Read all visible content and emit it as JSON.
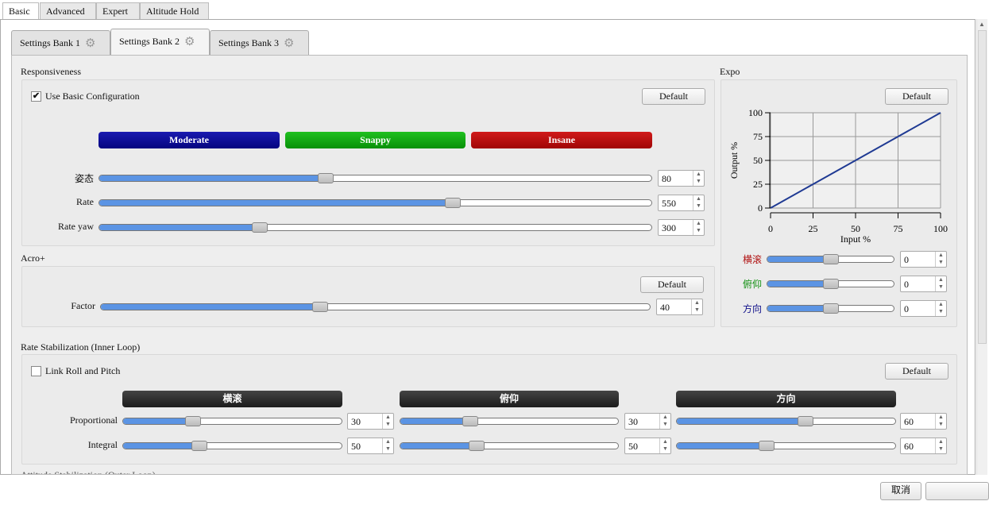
{
  "top_tabs": [
    "Basic",
    "Advanced",
    "Expert",
    "Altitude Hold"
  ],
  "bank_tabs": [
    "Settings Bank 1",
    "Settings Bank 2",
    "Settings Bank 3"
  ],
  "responsiveness": {
    "title": "Responsiveness",
    "use_basic": {
      "label": "Use Basic Configuration",
      "checked": true
    },
    "default_label": "Default",
    "presets": [
      {
        "label": "Moderate",
        "color": "#0a0a9a"
      },
      {
        "label": "Snappy",
        "color": "#12a812"
      },
      {
        "label": "Insane",
        "color": "#b80a0a"
      }
    ],
    "rows": [
      {
        "label": "姿态",
        "value": "80",
        "level": 0.41
      },
      {
        "label": "Rate",
        "value": "550",
        "level": 0.64
      },
      {
        "label": "Rate yaw",
        "value": "300",
        "level": 0.29
      }
    ]
  },
  "acro": {
    "title": "Acro+",
    "default_label": "Default",
    "rows": [
      {
        "label": "Factor",
        "value": "40",
        "level": 0.4
      }
    ]
  },
  "expo": {
    "title": "Expo",
    "default_label": "Default",
    "rows": [
      {
        "label": "横滚",
        "value": "0",
        "color": "#b01010",
        "level": 0.5
      },
      {
        "label": "俯仰",
        "value": "0",
        "color": "#109010",
        "level": 0.5
      },
      {
        "label": "方向",
        "value": "0",
        "color": "#10108a",
        "level": 0.5
      }
    ]
  },
  "chart_data": {
    "type": "line",
    "xlabel": "Input %",
    "ylabel": "Output %",
    "xlim": [
      0,
      100
    ],
    "ylim": [
      0,
      100
    ],
    "xticks": [
      "0",
      "25",
      "50",
      "75",
      "100"
    ],
    "yticks": [
      "0",
      "25",
      "50",
      "75",
      "100"
    ],
    "grid": true,
    "series": [
      {
        "x": [
          0,
          25,
          50,
          75,
          100
        ],
        "y": [
          0,
          25,
          50,
          75,
          100
        ],
        "color": "#1f3a93"
      }
    ]
  },
  "rate_stab": {
    "title": "Rate Stabilization (Inner Loop)",
    "link": {
      "label": "Link Roll and Pitch",
      "checked": false
    },
    "default_label": "Default",
    "columns": [
      "横滚",
      "俯仰",
      "方向"
    ],
    "row_labels": [
      "Proportional",
      "Integral"
    ],
    "values": [
      [
        {
          "value": "30",
          "level": 0.32
        },
        {
          "value": "30",
          "level": 0.32
        },
        {
          "value": "60",
          "level": 0.59
        }
      ],
      [
        {
          "value": "50",
          "level": 0.35
        },
        {
          "value": "50",
          "level": 0.35
        },
        {
          "value": "60",
          "level": 0.41
        }
      ]
    ]
  },
  "next_section": "Attitude Stabilization (Outer Loop)",
  "footer": {
    "cancel_label": "取消"
  }
}
